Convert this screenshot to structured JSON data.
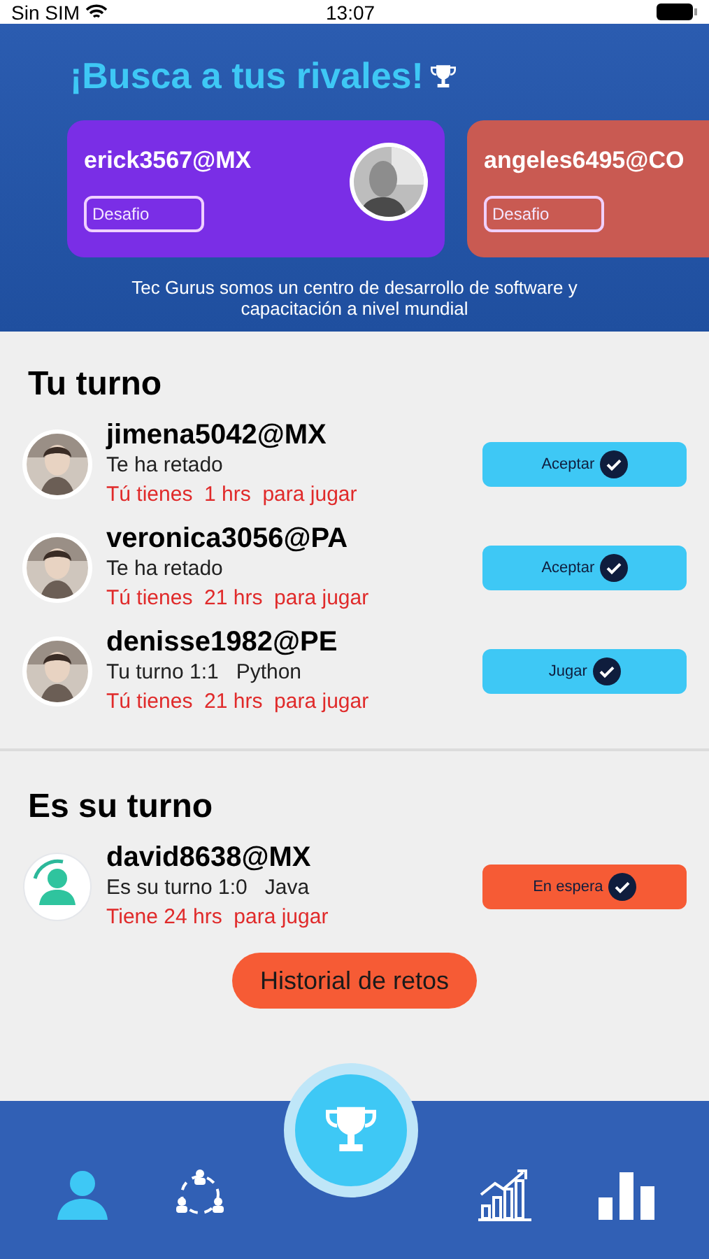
{
  "status_bar": {
    "carrier": "Sin SIM",
    "time": "13:07"
  },
  "header": {
    "title": "¡Busca a tus rivales!",
    "rivals": [
      {
        "name": "erick3567@MX",
        "button": "Desafio",
        "color": "#7a2ee6",
        "kind": "picture"
      },
      {
        "name": "angeles6495@CO",
        "button": "Desafio",
        "color": "#c95a52"
      }
    ],
    "tagline": "Tec Gurus somos un centro de desarrollo de software y capacitación a nivel mundial"
  },
  "sections": [
    {
      "title": "Tu turno",
      "rows": [
        {
          "user": "jimena5042@MX",
          "status": "Te ha retado",
          "time_note": "Tú tienes  1 hrs  para jugar",
          "action": {
            "label": "Aceptar",
            "kind": "go"
          }
        },
        {
          "user": "veronica3056@PA",
          "status": "Te ha retado",
          "time_note": "Tú tienes  21 hrs  para jugar",
          "action": {
            "label": "Aceptar",
            "kind": "go"
          }
        },
        {
          "user": "denisse1982@PE",
          "status": "Tu turno 1:1   Python",
          "time_note": "Tú tienes  21 hrs  para jugar",
          "action": {
            "label": "Jugar",
            "kind": "go"
          }
        }
      ]
    },
    {
      "title": "Es su turno",
      "rows": [
        {
          "user": "david8638@MX",
          "status": "Es su turno 1:0   Java",
          "time_note": "Tiene 24 hrs  para jugar",
          "kind": "default",
          "action": {
            "label": "En espera",
            "kind": "wait"
          }
        }
      ]
    }
  ],
  "history_button": "Historial de retos",
  "nav": [
    {
      "kind": "profile",
      "selected": true
    },
    {
      "kind": "network",
      "selected": false
    },
    {
      "kind": "trophy",
      "selected": false
    },
    {
      "kind": "growth",
      "selected": false
    },
    {
      "kind": "bars",
      "selected": false
    }
  ]
}
